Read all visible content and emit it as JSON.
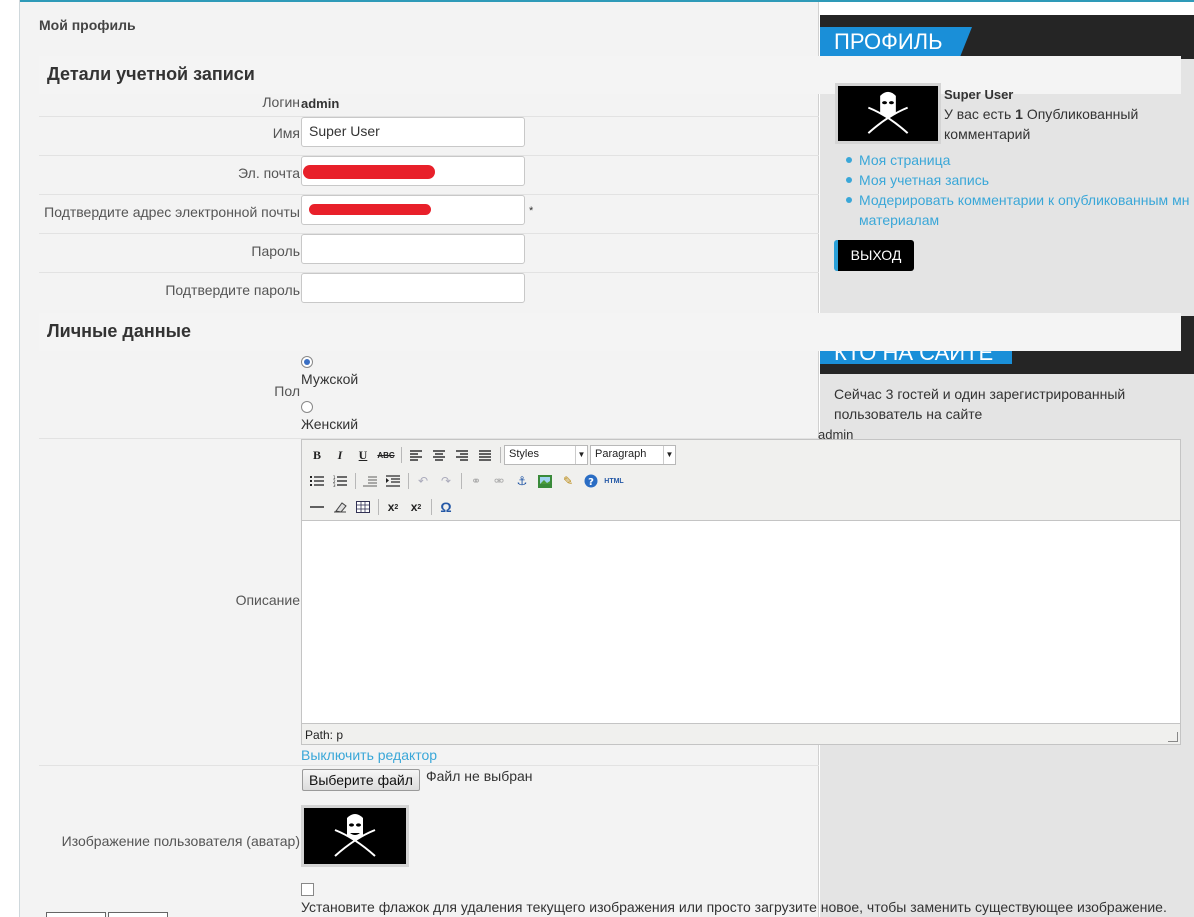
{
  "page": {
    "title": "Мой профиль"
  },
  "account": {
    "section_title": "Детали учетной записи",
    "login_label": "Логин",
    "login_value": "admin",
    "name_label": "Имя",
    "name_value": "Super User",
    "email_label": "Эл. почта",
    "email_confirm_label": "Подтвердите адрес электронной почты",
    "required_mark": "*",
    "password_label": "Пароль",
    "password_confirm_label": "Подтвердите пароль"
  },
  "personal": {
    "section_title": "Личные данные",
    "gender_label": "Пол",
    "gender_options": [
      "Мужской",
      "Женский"
    ],
    "gender_selected": "Мужской",
    "description_label": "Описание",
    "toolbar": {
      "styles_select": "Styles",
      "format_select": "Paragraph",
      "html_label": "HTML"
    },
    "path_label": "Path: p",
    "toggle_editor_link": "Выключить редактор",
    "avatar_label": "Изображение пользователя (аватар)",
    "file_button": "Выберите файл",
    "file_status": "Файл не выбран",
    "delete_avatar_hint": "Установите флажок для удаления текущего изображения или просто загрузите новое, чтобы заменить существующее изображение."
  },
  "sidebar": {
    "profile_module": {
      "title": "ПРОФИЛЬ",
      "user_name": "Super User",
      "comment_prefix": "У вас есть",
      "comment_count": "1",
      "comment_suffix_1": "Опубликованный",
      "comment_suffix_2": "комментарий",
      "links": [
        "Моя страница",
        "Моя учетная запись",
        "Модерировать комментарии к опубликованным мн",
        "материалам"
      ],
      "logout": "ВЫХОД"
    },
    "online_module": {
      "title": "КТО НА САЙТЕ",
      "text_1": "Сейчас 3 гостей и один зарегистрированный",
      "text_2": "пользователь на сайте",
      "user": "admin"
    }
  },
  "colors": {
    "accent": "#1a8fd8",
    "link": "#3aa7d8",
    "module_header": "#252525",
    "redaction": "#e8202a"
  }
}
